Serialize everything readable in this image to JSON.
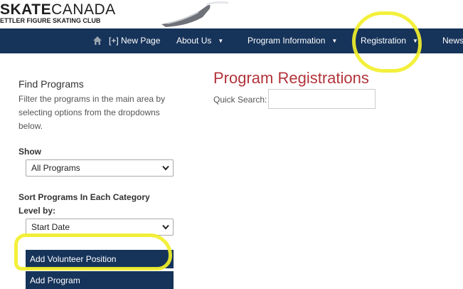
{
  "brand": {
    "name_bold": "SKATE",
    "name_thin": "CANADA",
    "club": "ETTLER FIGURE SKATING CLUB"
  },
  "nav": {
    "items": [
      {
        "label": "[+] New Page",
        "dropdown": false
      },
      {
        "label": "About Us",
        "dropdown": true
      },
      {
        "label": "Program Information",
        "dropdown": true
      },
      {
        "label": "Registration",
        "dropdown": true
      },
      {
        "label": "News",
        "dropdown": false
      }
    ],
    "dropdown_caret": "▼"
  },
  "sidebar": {
    "title": "Find Programs",
    "description": "Filter the programs in the main area by selecting options from the dropdowns below.",
    "show_label": "Show",
    "show_value": "All Programs",
    "sort_label": "Sort Programs In Each Category Level by:",
    "sort_value": "Start Date",
    "buttons": {
      "add_volunteer": "Add Volunteer Position",
      "add_program": "Add Program"
    }
  },
  "main": {
    "title": "Program Registrations",
    "quick_search_label": "Quick Search:",
    "quick_search_value": ""
  },
  "colors": {
    "nav_bg": "#16335a",
    "title_red": "#b2333a",
    "highlight": "#f2ef2b"
  }
}
